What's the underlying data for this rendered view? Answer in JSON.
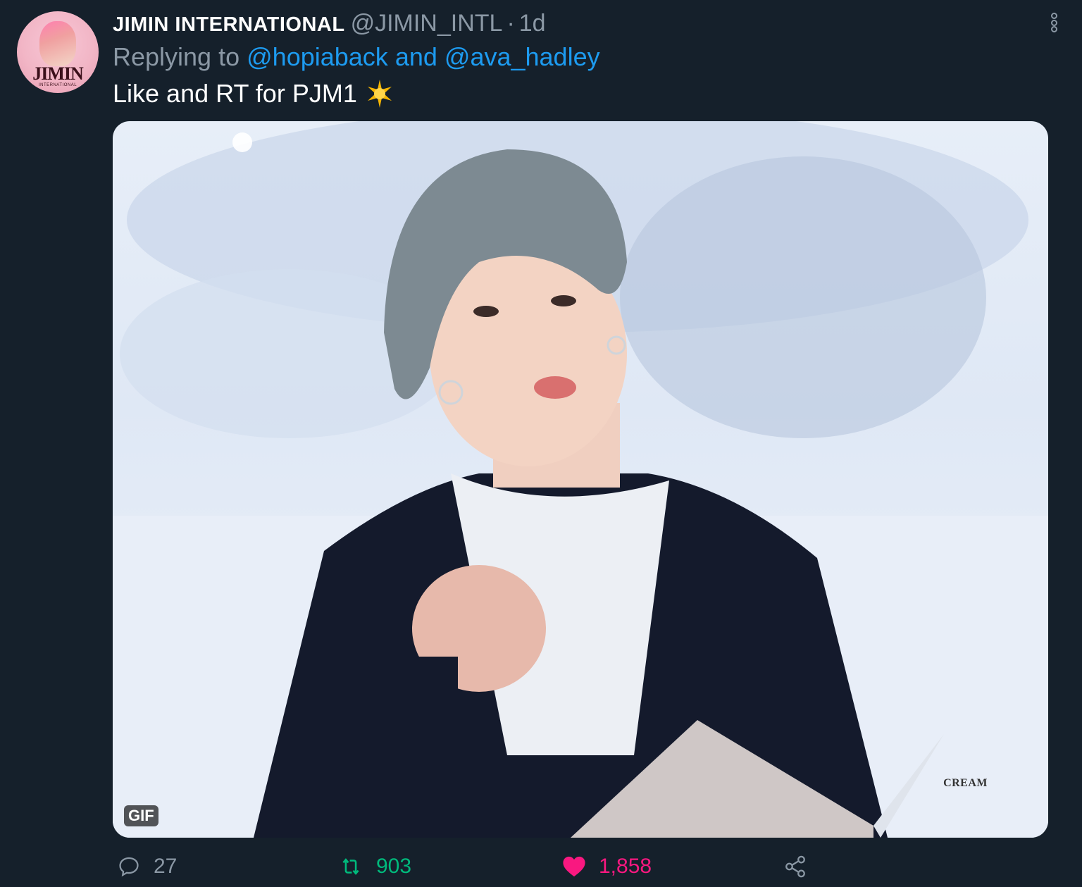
{
  "tweet": {
    "display_name": "JIMIN INTERNATIONAL",
    "handle": "@JIMIN_INTL",
    "separator": "·",
    "time": "1d",
    "replying_prefix": "Replying to",
    "reply_to_1": "@hopiaback",
    "reply_conjunction": "and",
    "reply_to_2": "@ava_hadley",
    "text": "Like and RT for PJM1"
  },
  "avatar": {
    "logo_text": "JIMIN",
    "logo_subtext": "INTERNATIONAL"
  },
  "media": {
    "badge": "GIF",
    "watermark": "CREAM"
  },
  "actions": {
    "replies": "27",
    "retweets": "903",
    "likes": "1,858"
  },
  "colors": {
    "background": "#15202b",
    "secondary_text": "#8b98a5",
    "link": "#1d9bf0",
    "retweet": "#00ba7c",
    "like": "#f91880"
  },
  "icons": {
    "more": "more-options-icon",
    "reply": "reply-icon",
    "retweet": "retweet-icon",
    "like": "heart-icon",
    "share": "share-icon",
    "emoji": "sun-emoji-icon"
  }
}
